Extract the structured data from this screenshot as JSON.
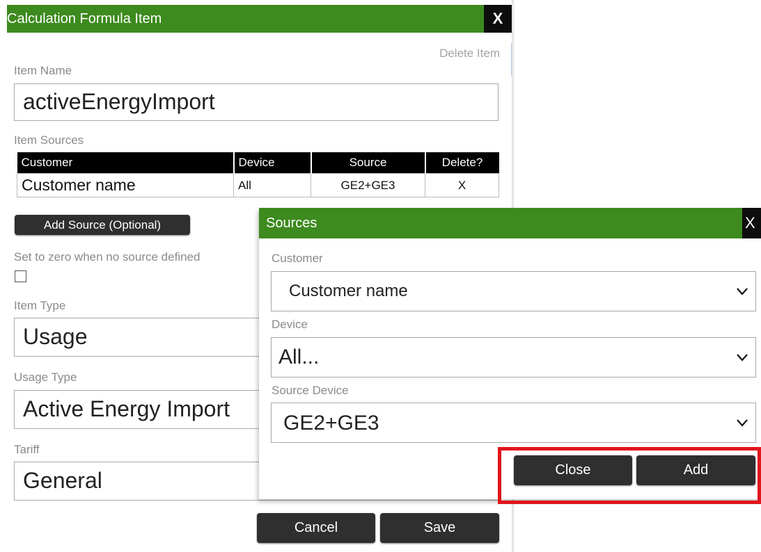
{
  "main_dialog": {
    "title": "Calculation Formula Item",
    "close_label": "X",
    "delete_item": "Delete Item",
    "item_name_label": "Item Name",
    "item_name_value": "activeEnergyImport",
    "item_sources_label": "Item Sources",
    "sources_table": {
      "columns": [
        "Customer",
        "Device",
        "Source",
        "Delete?"
      ],
      "rows": [
        [
          "Customer name",
          "All",
          "GE2+GE3",
          "X"
        ]
      ]
    },
    "add_source_button": "Add Source (Optional)",
    "zero_label": "Set to zero when no source defined",
    "item_type_label": "Item Type",
    "item_type_value": "Usage",
    "usage_type_label": "Usage Type",
    "usage_type_value": "Active Energy Import",
    "tariff_label": "Tariff",
    "tariff_value": "General",
    "cancel_button": "Cancel",
    "save_button": "Save"
  },
  "sources_dialog": {
    "title": "Sources",
    "close_label": "X",
    "customer_label": "Customer",
    "customer_value": "Customer name",
    "device_label": "Device",
    "device_value": "All...",
    "source_device_label": "Source Device",
    "source_device_value": "GE2+GE3",
    "close_button": "Close",
    "add_button": "Add"
  },
  "colors": {
    "titlebar_green": "#3d8a1e",
    "button_dark": "#2f2f2f",
    "highlight_red": "#e1141c"
  },
  "icons": [
    "chevron-down-icon"
  ]
}
